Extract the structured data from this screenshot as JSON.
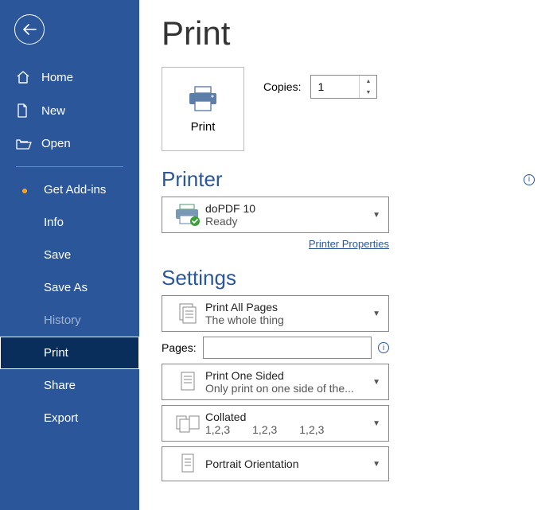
{
  "sidebar": {
    "items": [
      {
        "label": "Home"
      },
      {
        "label": "New"
      },
      {
        "label": "Open"
      },
      {
        "label": "Get Add-ins"
      },
      {
        "label": "Info"
      },
      {
        "label": "Save"
      },
      {
        "label": "Save As"
      },
      {
        "label": "History"
      },
      {
        "label": "Print"
      },
      {
        "label": "Share"
      },
      {
        "label": "Export"
      }
    ]
  },
  "page": {
    "title": "Print"
  },
  "printCard": {
    "label": "Print"
  },
  "copies": {
    "label": "Copies:",
    "value": "1"
  },
  "printer": {
    "heading": "Printer",
    "name": "doPDF 10",
    "status": "Ready",
    "propertiesLink": "Printer Properties"
  },
  "settings": {
    "heading": "Settings",
    "printWhat": {
      "title": "Print All Pages",
      "sub": "The whole thing"
    },
    "pagesLabel": "Pages:",
    "pagesValue": "",
    "sides": {
      "title": "Print One Sided",
      "sub": "Only print on one side of the..."
    },
    "collate": {
      "title": "Collated",
      "sub": "1,2,3  1,2,3  1,2,3"
    },
    "orientation": {
      "title": "Portrait Orientation"
    }
  }
}
